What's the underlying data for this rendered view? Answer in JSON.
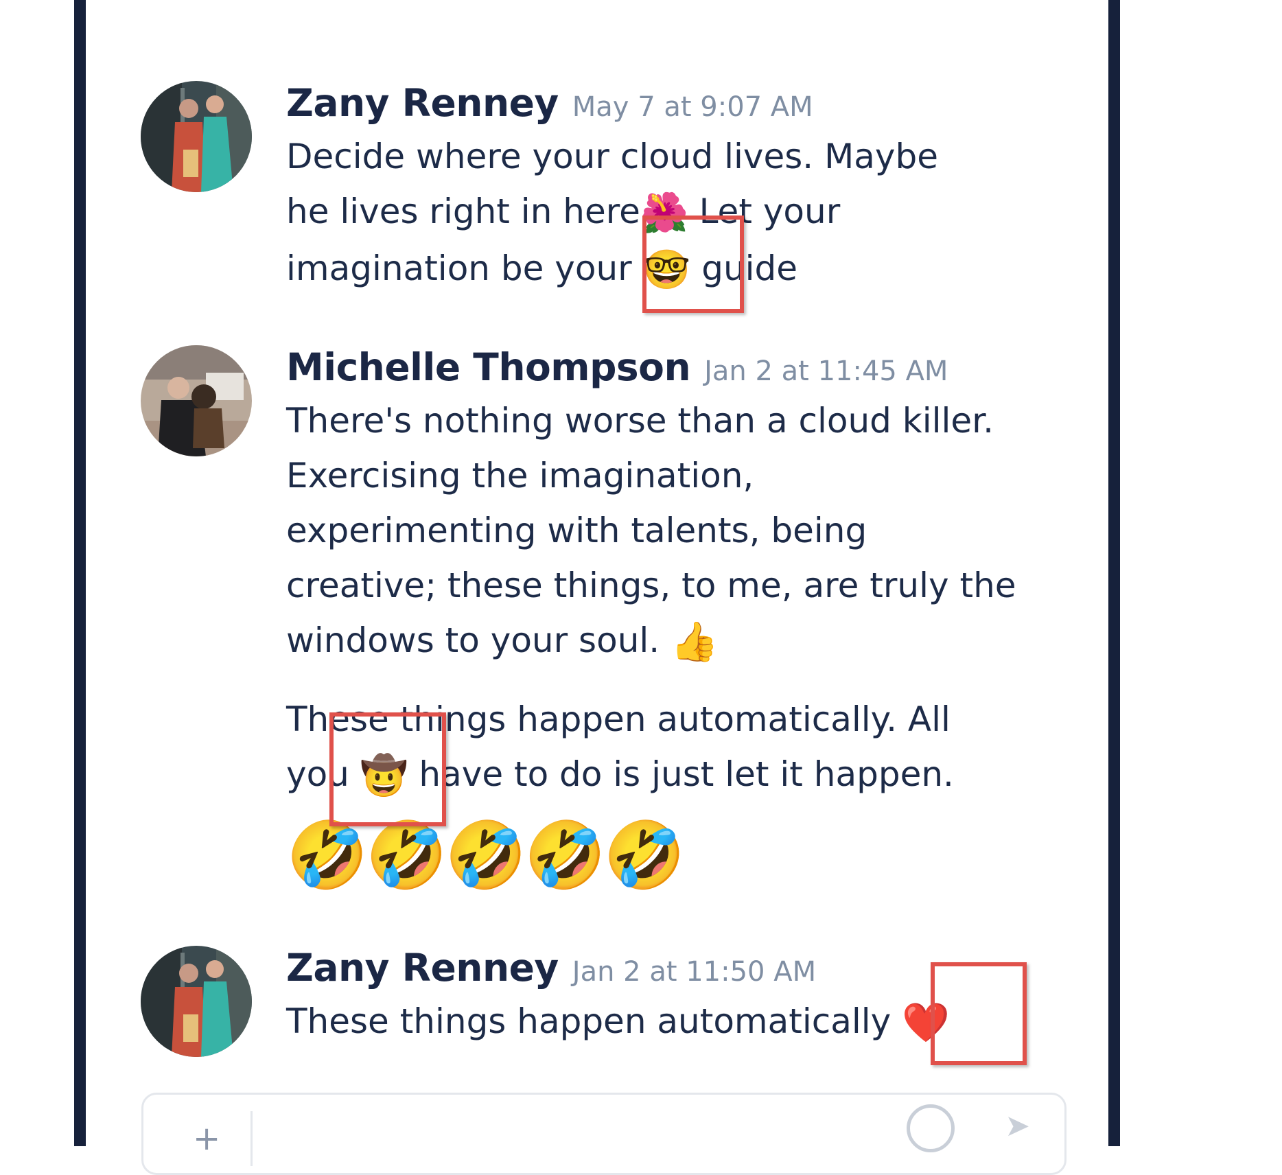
{
  "messages": [
    {
      "author": "Zany Renney",
      "time": "May 7 at 9:07 AM",
      "avatar_icon": "avatar-woman-teal-coat",
      "line1": "Decide where your cloud lives. Maybe",
      "line2_pre": "he lives right in here",
      "flower_emoji": "🌺",
      "line2_post": " Let your",
      "line3_pre": "imagination be your ",
      "nerd_emoji": "🤓",
      "line3_post": " guide"
    },
    {
      "author": "Michelle Thompson",
      "time": "Jan 2 at 11:45 AM",
      "avatar_icon": "avatar-woman-with-dog",
      "para1_lines": [
        "There's nothing worse than a cloud killer.",
        "Exercising the imagination,",
        "experimenting with talents, being",
        "creative; these things, to me, are truly the"
      ],
      "para1_last_pre": "windows to your soul. ",
      "thumbs_emoji": "👍",
      "para2_line1": "These things happen automatically. All",
      "para2_line2_pre": "you ",
      "cowboy_emoji": "🤠",
      "para2_line2_post": " have to do is just let it happen.",
      "laugh_emojis": "🤣🤣🤣🤣🤣"
    },
    {
      "author": "Zany Renney",
      "time": "Jan 2 at 11:50 AM",
      "avatar_icon": "avatar-woman-teal-coat",
      "text_pre": "These things happen automatically",
      "heart_emoji": "❤️"
    }
  ],
  "composer": {
    "plus_icon": "+",
    "emoji_icon": "emoji-picker-icon",
    "send_icon": "send-icon"
  },
  "colors": {
    "highlight": "#e0514b",
    "author": "#1b2745",
    "time": "#7f8ea3",
    "frame": "#16213b"
  }
}
